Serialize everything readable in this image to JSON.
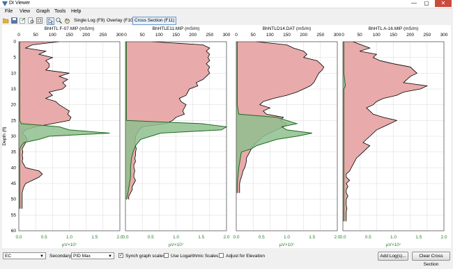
{
  "window": {
    "title": "DI Viewer",
    "minimize": "—",
    "maximize": "▢",
    "close": "✕"
  },
  "menu": [
    "File",
    "View",
    "Graph",
    "Tools",
    "Help"
  ],
  "toolbar": {
    "single_log": "Single Log (F9)",
    "overlay": "Overlay (F10)",
    "cross_section": "Cross Section (F11)"
  },
  "colors": {
    "ec_fill": "#e8aaaa",
    "pid_fill": "#8fbf8f",
    "pid_line": "#1d6b1d",
    "ec_line": "#000000"
  },
  "chart_data": [
    {
      "type": "area",
      "title": "BhHTL F-07.MIP (mS/m)",
      "ylabel": "Depth (ft)",
      "x_top": {
        "ticks": [
          "0",
          "50",
          "100",
          "150",
          "200",
          "250",
          "300"
        ],
        "range": [
          0,
          300
        ]
      },
      "x_bottom": {
        "ticks": [
          "0.0",
          "0.5",
          "1.0",
          "1.5",
          "2.0"
        ],
        "label": "µV×10⁷",
        "range": [
          0,
          2.0
        ]
      },
      "y_ticks": [
        "0",
        "5",
        "10",
        "15",
        "20",
        "25",
        "30",
        "35",
        "40",
        "45",
        "50",
        "55",
        "60"
      ],
      "ylim": [
        0,
        60
      ],
      "ec": [
        [
          0,
          120
        ],
        [
          1,
          40
        ],
        [
          2,
          20
        ],
        [
          3,
          80
        ],
        [
          4,
          60
        ],
        [
          5,
          100
        ],
        [
          6,
          80
        ],
        [
          7,
          90
        ],
        [
          8,
          90
        ],
        [
          9,
          80
        ],
        [
          10,
          150
        ],
        [
          11,
          120
        ],
        [
          12,
          145
        ],
        [
          13,
          130
        ],
        [
          14,
          140
        ],
        [
          15,
          130
        ],
        [
          16,
          90
        ],
        [
          17,
          100
        ],
        [
          18,
          80
        ],
        [
          19,
          110
        ],
        [
          20,
          120
        ],
        [
          21,
          135
        ],
        [
          22,
          150
        ],
        [
          23,
          145
        ],
        [
          24,
          155
        ],
        [
          25,
          150
        ],
        [
          26,
          100
        ],
        [
          27,
          50
        ],
        [
          28,
          20
        ],
        [
          29,
          10
        ],
        [
          30,
          20
        ],
        [
          31,
          25
        ],
        [
          32,
          20
        ],
        [
          33,
          15
        ],
        [
          34,
          10
        ],
        [
          35,
          12
        ],
        [
          36,
          10
        ],
        [
          37,
          12
        ],
        [
          38,
          10
        ],
        [
          39,
          15
        ],
        [
          40,
          20
        ],
        [
          41,
          60
        ],
        [
          42,
          70
        ],
        [
          43,
          60
        ],
        [
          44,
          40
        ],
        [
          45,
          20
        ],
        [
          46,
          15
        ],
        [
          47,
          12
        ],
        [
          48,
          10
        ],
        [
          49,
          10
        ],
        [
          50,
          10
        ],
        [
          51,
          10
        ],
        [
          52,
          10
        ],
        [
          53,
          10
        ]
      ],
      "pid": [
        [
          0,
          0.02
        ],
        [
          5,
          0.02
        ],
        [
          10,
          0.02
        ],
        [
          15,
          0.02
        ],
        [
          20,
          0.02
        ],
        [
          25,
          0.02
        ],
        [
          26,
          0.05
        ],
        [
          27,
          0.8
        ],
        [
          28,
          1.0
        ],
        [
          29,
          1.8
        ],
        [
          30,
          0.6
        ],
        [
          31,
          0.4
        ],
        [
          32,
          0.1
        ],
        [
          33,
          0.05
        ],
        [
          34,
          0.02
        ],
        [
          40,
          0.02
        ],
        [
          50,
          0.02
        ],
        [
          53,
          0.02
        ]
      ]
    },
    {
      "type": "area",
      "title": "BhHTLE11.MIP (mS/m)",
      "ylabel": "",
      "x_top": {
        "ticks": [
          "0",
          "50",
          "100",
          "150",
          "200",
          "250",
          "300"
        ],
        "range": [
          0,
          300
        ]
      },
      "x_bottom": {
        "ticks": [
          "0.0",
          "0.5",
          "1.0",
          "1.5",
          "2.0"
        ],
        "label": "µV×10⁷",
        "range": [
          0,
          2.0
        ]
      },
      "y_ticks": [],
      "ylim": [
        0,
        60
      ],
      "ec": [
        [
          0,
          80
        ],
        [
          1,
          230
        ],
        [
          2,
          250
        ],
        [
          3,
          240
        ],
        [
          4,
          250
        ],
        [
          5,
          245
        ],
        [
          6,
          250
        ],
        [
          7,
          240
        ],
        [
          8,
          250
        ],
        [
          9,
          245
        ],
        [
          10,
          250
        ],
        [
          11,
          240
        ],
        [
          12,
          230
        ],
        [
          13,
          210
        ],
        [
          14,
          215
        ],
        [
          15,
          190
        ],
        [
          16,
          185
        ],
        [
          17,
          180
        ],
        [
          18,
          160
        ],
        [
          19,
          165
        ],
        [
          20,
          180
        ],
        [
          21,
          175
        ],
        [
          22,
          170
        ],
        [
          23,
          175
        ],
        [
          24,
          150
        ],
        [
          25,
          140
        ],
        [
          26,
          120
        ],
        [
          27,
          50
        ],
        [
          28,
          40
        ],
        [
          29,
          35
        ],
        [
          30,
          30
        ],
        [
          31,
          30
        ],
        [
          32,
          28
        ],
        [
          33,
          30
        ],
        [
          34,
          32
        ],
        [
          35,
          30
        ],
        [
          36,
          30
        ],
        [
          37,
          28
        ],
        [
          38,
          30
        ],
        [
          39,
          25
        ],
        [
          40,
          25
        ],
        [
          41,
          28
        ],
        [
          42,
          25
        ],
        [
          43,
          25
        ],
        [
          44,
          30
        ],
        [
          45,
          25
        ],
        [
          46,
          20
        ],
        [
          47,
          20
        ],
        [
          48,
          15
        ],
        [
          49,
          10
        ],
        [
          50,
          10
        ]
      ],
      "pid": [
        [
          0,
          0.02
        ],
        [
          10,
          0.02
        ],
        [
          20,
          0.02
        ],
        [
          25,
          0.02
        ],
        [
          26,
          1.5
        ],
        [
          27,
          2.0
        ],
        [
          28,
          1.9
        ],
        [
          29,
          0.7
        ],
        [
          30,
          0.5
        ],
        [
          31,
          0.3
        ],
        [
          32,
          0.25
        ],
        [
          33,
          0.2
        ],
        [
          35,
          0.15
        ],
        [
          37,
          0.12
        ],
        [
          40,
          0.1
        ],
        [
          43,
          0.1
        ],
        [
          45,
          0.08
        ],
        [
          48,
          0.05
        ],
        [
          50,
          0.02
        ]
      ]
    },
    {
      "type": "area",
      "title": "BhNTLD14.DAT (mS/m)",
      "ylabel": "",
      "x_top": {
        "ticks": [
          "0",
          "50",
          "100",
          "150",
          "200",
          "250",
          "300"
        ],
        "range": [
          0,
          300
        ]
      },
      "x_bottom": {
        "ticks": [
          "0.0",
          "0.5",
          "1.0",
          "1.5",
          "2.0"
        ],
        "label": "µV×10⁷",
        "range": [
          0,
          2.0
        ]
      },
      "y_ticks": [],
      "ylim": [
        0,
        60
      ],
      "ec": [
        [
          0,
          60
        ],
        [
          1,
          150
        ],
        [
          2,
          170
        ],
        [
          3,
          200
        ],
        [
          4,
          210
        ],
        [
          5,
          200
        ],
        [
          6,
          240
        ],
        [
          7,
          250
        ],
        [
          8,
          260
        ],
        [
          9,
          255
        ],
        [
          10,
          245
        ],
        [
          11,
          240
        ],
        [
          12,
          235
        ],
        [
          13,
          230
        ],
        [
          14,
          220
        ],
        [
          15,
          200
        ],
        [
          16,
          180
        ],
        [
          17,
          150
        ],
        [
          18,
          110
        ],
        [
          19,
          80
        ],
        [
          20,
          70
        ],
        [
          21,
          100
        ],
        [
          22,
          80
        ],
        [
          23,
          90
        ],
        [
          24,
          140
        ],
        [
          25,
          130
        ],
        [
          26,
          150
        ],
        [
          27,
          140
        ],
        [
          28,
          120
        ],
        [
          29,
          100
        ],
        [
          30,
          80
        ],
        [
          31,
          70
        ],
        [
          32,
          60
        ],
        [
          33,
          50
        ],
        [
          34,
          45
        ],
        [
          35,
          40
        ],
        [
          36,
          35
        ],
        [
          37,
          30
        ],
        [
          38,
          30
        ],
        [
          39,
          28
        ],
        [
          40,
          25
        ],
        [
          41,
          20
        ],
        [
          42,
          18
        ],
        [
          43,
          15
        ],
        [
          44,
          12
        ],
        [
          45,
          10
        ],
        [
          46,
          10
        ],
        [
          47,
          10
        ],
        [
          48,
          10
        ]
      ],
      "pid": [
        [
          0,
          0.02
        ],
        [
          10,
          0.02
        ],
        [
          20,
          0.02
        ],
        [
          23,
          0.05
        ],
        [
          24,
          0.8
        ],
        [
          25,
          1.0
        ],
        [
          26,
          1.2
        ],
        [
          27,
          0.9
        ],
        [
          28,
          1.0
        ],
        [
          29,
          1.5
        ],
        [
          30,
          1.2
        ],
        [
          31,
          0.8
        ],
        [
          32,
          0.6
        ],
        [
          33,
          0.4
        ],
        [
          34,
          0.3
        ],
        [
          35,
          0.1
        ],
        [
          40,
          0.05
        ],
        [
          45,
          0.02
        ],
        [
          48,
          0.02
        ]
      ]
    },
    {
      "type": "area",
      "title": "BhHTL A-16.MIP (mS/m)",
      "ylabel": "",
      "x_top": {
        "ticks": [
          "0",
          "50",
          "100",
          "150",
          "200",
          "250",
          "300"
        ],
        "range": [
          0,
          300
        ]
      },
      "x_bottom": {
        "ticks": [
          "0.0",
          "0.5",
          "1.0",
          "1.5",
          "2.0"
        ],
        "label": "µV×10⁷",
        "range": [
          0,
          2.0
        ]
      },
      "y_ticks": [],
      "ylim": [
        0,
        60
      ],
      "ec": [
        [
          0,
          30
        ],
        [
          2,
          80
        ],
        [
          3,
          50
        ],
        [
          4,
          100
        ],
        [
          5,
          90
        ],
        [
          6,
          110
        ],
        [
          7,
          150
        ],
        [
          8,
          200
        ],
        [
          9,
          210
        ],
        [
          10,
          220
        ],
        [
          11,
          200
        ],
        [
          12,
          190
        ],
        [
          13,
          180
        ],
        [
          14,
          250
        ],
        [
          15,
          230
        ],
        [
          16,
          180
        ],
        [
          17,
          160
        ],
        [
          18,
          120
        ],
        [
          19,
          100
        ],
        [
          20,
          90
        ],
        [
          21,
          70
        ],
        [
          22,
          80
        ],
        [
          23,
          90
        ],
        [
          24,
          120
        ],
        [
          25,
          160
        ],
        [
          26,
          140
        ],
        [
          27,
          120
        ],
        [
          28,
          100
        ],
        [
          29,
          90
        ],
        [
          30,
          80
        ],
        [
          31,
          70
        ],
        [
          32,
          60
        ],
        [
          33,
          80
        ],
        [
          34,
          70
        ],
        [
          35,
          60
        ],
        [
          36,
          50
        ],
        [
          37,
          40
        ],
        [
          38,
          35
        ],
        [
          39,
          30
        ],
        [
          40,
          25
        ],
        [
          41,
          20
        ],
        [
          42,
          10
        ],
        [
          43,
          10
        ],
        [
          44,
          20
        ],
        [
          45,
          10
        ],
        [
          46,
          15
        ],
        [
          47,
          10
        ],
        [
          48,
          10
        ],
        [
          49,
          15
        ],
        [
          50,
          10
        ],
        [
          51,
          10
        ],
        [
          52,
          10
        ],
        [
          53,
          12
        ],
        [
          54,
          10
        ],
        [
          55,
          10
        ],
        [
          56,
          10
        ],
        [
          57,
          10
        ]
      ],
      "pid": [
        [
          0,
          0.02
        ],
        [
          10,
          0.02
        ],
        [
          14,
          0.05
        ],
        [
          15,
          0.02
        ],
        [
          20,
          0.02
        ],
        [
          25,
          0.02
        ],
        [
          30,
          0.02
        ],
        [
          35,
          0.02
        ],
        [
          40,
          0.02
        ],
        [
          45,
          0.02
        ],
        [
          50,
          0.02
        ],
        [
          57,
          0.02
        ]
      ]
    }
  ],
  "bottom": {
    "primary_value": "EC",
    "secondary_label": "Secondary:",
    "secondary_value": "PID Max",
    "synch_label": "Synch graph scales",
    "synch_checked": "✓",
    "log_label": "Use Logarithmic Scales",
    "elev_label": "Adjust for Elevation",
    "add_logs": "Add Log(s)...",
    "clear_cross": "Clear Cross Section"
  }
}
